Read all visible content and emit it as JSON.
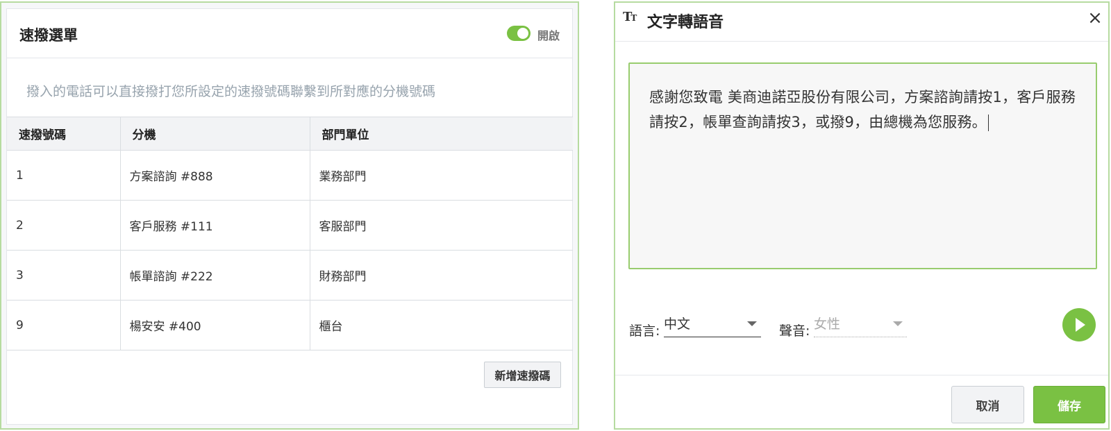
{
  "speed_dial": {
    "title": "速撥選單",
    "toggle_label": "開啟",
    "toggle_on": true,
    "description": "撥入的電話可以直接撥打您所設定的速撥號碼聯繫到所對應的分機號碼",
    "columns": [
      "速撥號碼",
      "分機",
      "部門單位"
    ],
    "rows": [
      [
        "1",
        "方案諮詢 #888",
        "業務部門"
      ],
      [
        "2",
        "客戶服務 #111",
        "客服部門"
      ],
      [
        "3",
        "帳單諮詢 #222",
        "財務部門"
      ],
      [
        "9",
        "楊安安 #400",
        "櫃台"
      ]
    ],
    "add_button": "新增速撥碼"
  },
  "tts": {
    "icon": "text-size-icon",
    "icon_glyph_big": "T",
    "icon_glyph_small": "T",
    "title": "文字轉語音",
    "close_glyph": "×",
    "text": "感謝您致電 美商迪諾亞股份有限公司，方案諮詢請按1，客戶服務請按2，帳單查詢請按3，或撥9，由總機為您服務。",
    "language_label": "語言:",
    "language_value": "中文",
    "voice_label": "聲音:",
    "voice_value": "女性",
    "cancel_button": "取消",
    "save_button": "儲存"
  },
  "colors": {
    "accent": "#7ac143",
    "border_green": "#b6dba0"
  }
}
